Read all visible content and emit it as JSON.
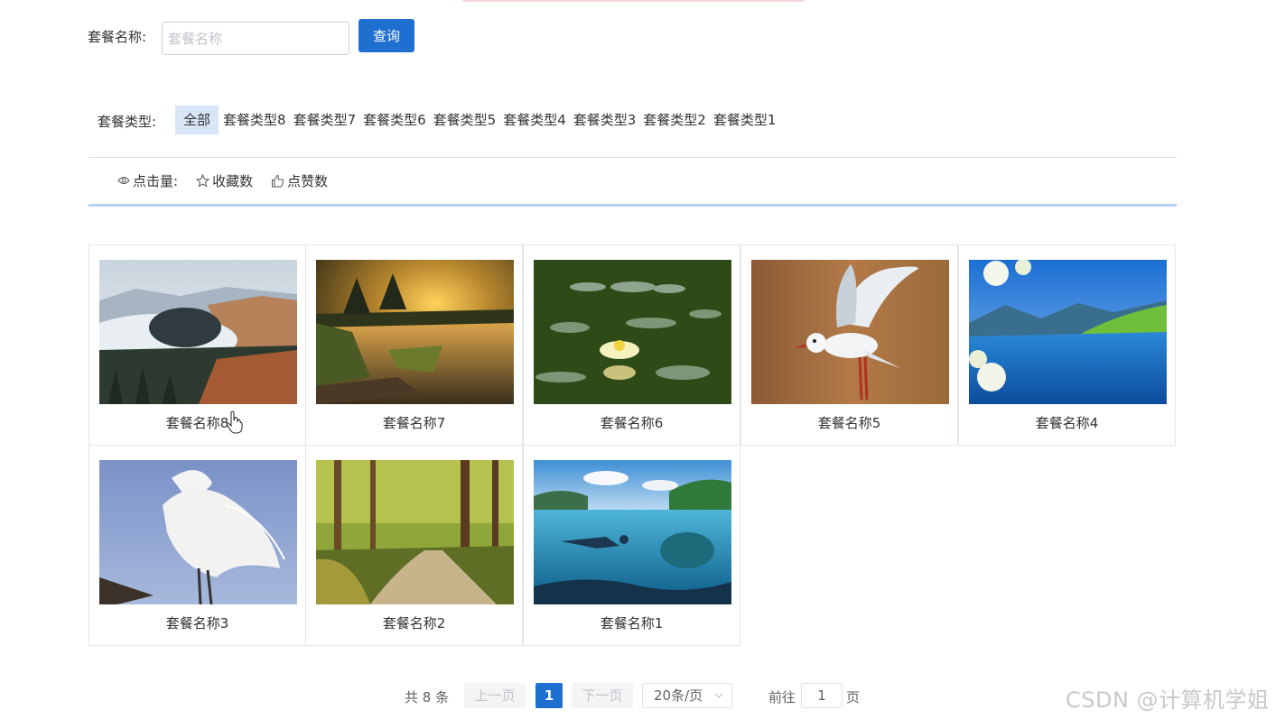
{
  "search": {
    "label": "套餐名称:",
    "placeholder": "套餐名称",
    "button": "查询"
  },
  "type_filter": {
    "label": "套餐类型:",
    "items": [
      "全部",
      "套餐类型8",
      "套餐类型7",
      "套餐类型6",
      "套餐类型5",
      "套餐类型4",
      "套餐类型3",
      "套餐类型2",
      "套餐类型1"
    ],
    "active": "全部"
  },
  "sort": {
    "views": "点击量:",
    "favorites": "收藏数",
    "likes": "点赞数"
  },
  "packages": [
    {
      "name": "套餐名称8",
      "image": "river-bend-landscape"
    },
    {
      "name": "套餐名称7",
      "image": "sunset-pond"
    },
    {
      "name": "套餐名称6",
      "image": "water-lily"
    },
    {
      "name": "套餐名称5",
      "image": "seagull"
    },
    {
      "name": "套餐名称4",
      "image": "mountain-lake"
    },
    {
      "name": "套餐名称3",
      "image": "white-egret"
    },
    {
      "name": "套餐名称2",
      "image": "forest-path"
    },
    {
      "name": "套餐名称1",
      "image": "diver-underwater"
    }
  ],
  "pagination": {
    "total": "共 8 条",
    "prev": "上一页",
    "current": "1",
    "next": "下一页",
    "page_size": "20条/页",
    "goto_prefix": "前往",
    "goto_value": "1",
    "goto_suffix": "页"
  },
  "watermark": "CSDN @计算机学姐",
  "colors": {
    "primary": "#1f6fd1",
    "active_tag": "#d8e6f8",
    "accent_line": "#b6d3f2"
  }
}
